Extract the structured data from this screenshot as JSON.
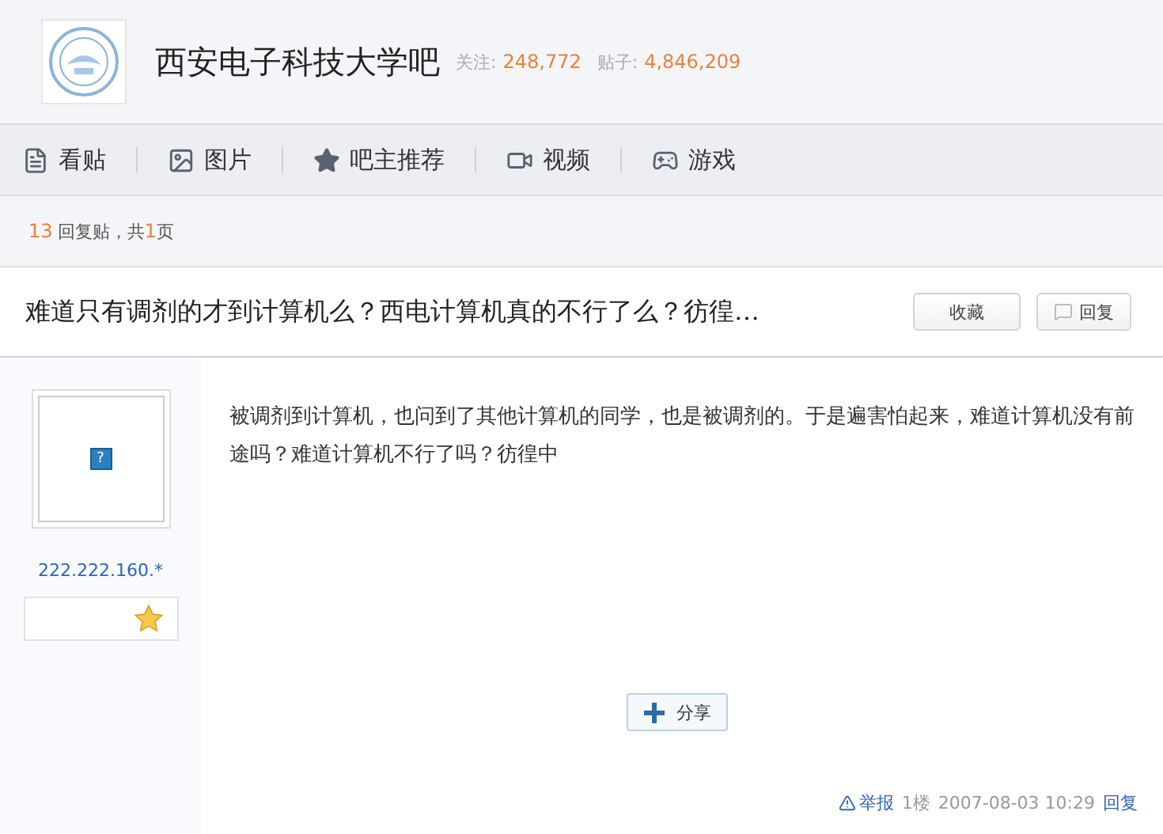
{
  "forum": {
    "name": "西安电子科技大学吧",
    "followers_label": "关注:",
    "followers": "248,772",
    "posts_label": "贴子:",
    "posts": "4,846,209"
  },
  "nav": [
    {
      "kind": "posts",
      "label": "看贴"
    },
    {
      "kind": "pictures",
      "label": "图片"
    },
    {
      "kind": "featured",
      "label": "吧主推荐"
    },
    {
      "kind": "video",
      "label": "视频"
    },
    {
      "kind": "games",
      "label": "游戏"
    }
  ],
  "summary": {
    "count": "13",
    "text": "回复贴，共",
    "pages": "1",
    "unit": "页"
  },
  "thread": {
    "title": "难道只有调剂的才到计算机么？西电计算机真的不行了么？彷徨…",
    "buttons": [
      {
        "kind": "plain",
        "label": "收藏"
      },
      {
        "kind": "reply",
        "label": "回复"
      }
    ]
  },
  "post": {
    "author": "222.222.160.*",
    "avatar_glyph": "?",
    "content": "被调剂到计算机，也问到了其他计算机的同学，也是被调剂的。于是遍害怕起来，难道计算机没有前途吗？难道计算机不行了吗？彷徨中",
    "share": "分享",
    "report": "举报",
    "floor": "1楼",
    "time": "2007-08-03 10:29",
    "reply": "回复"
  }
}
